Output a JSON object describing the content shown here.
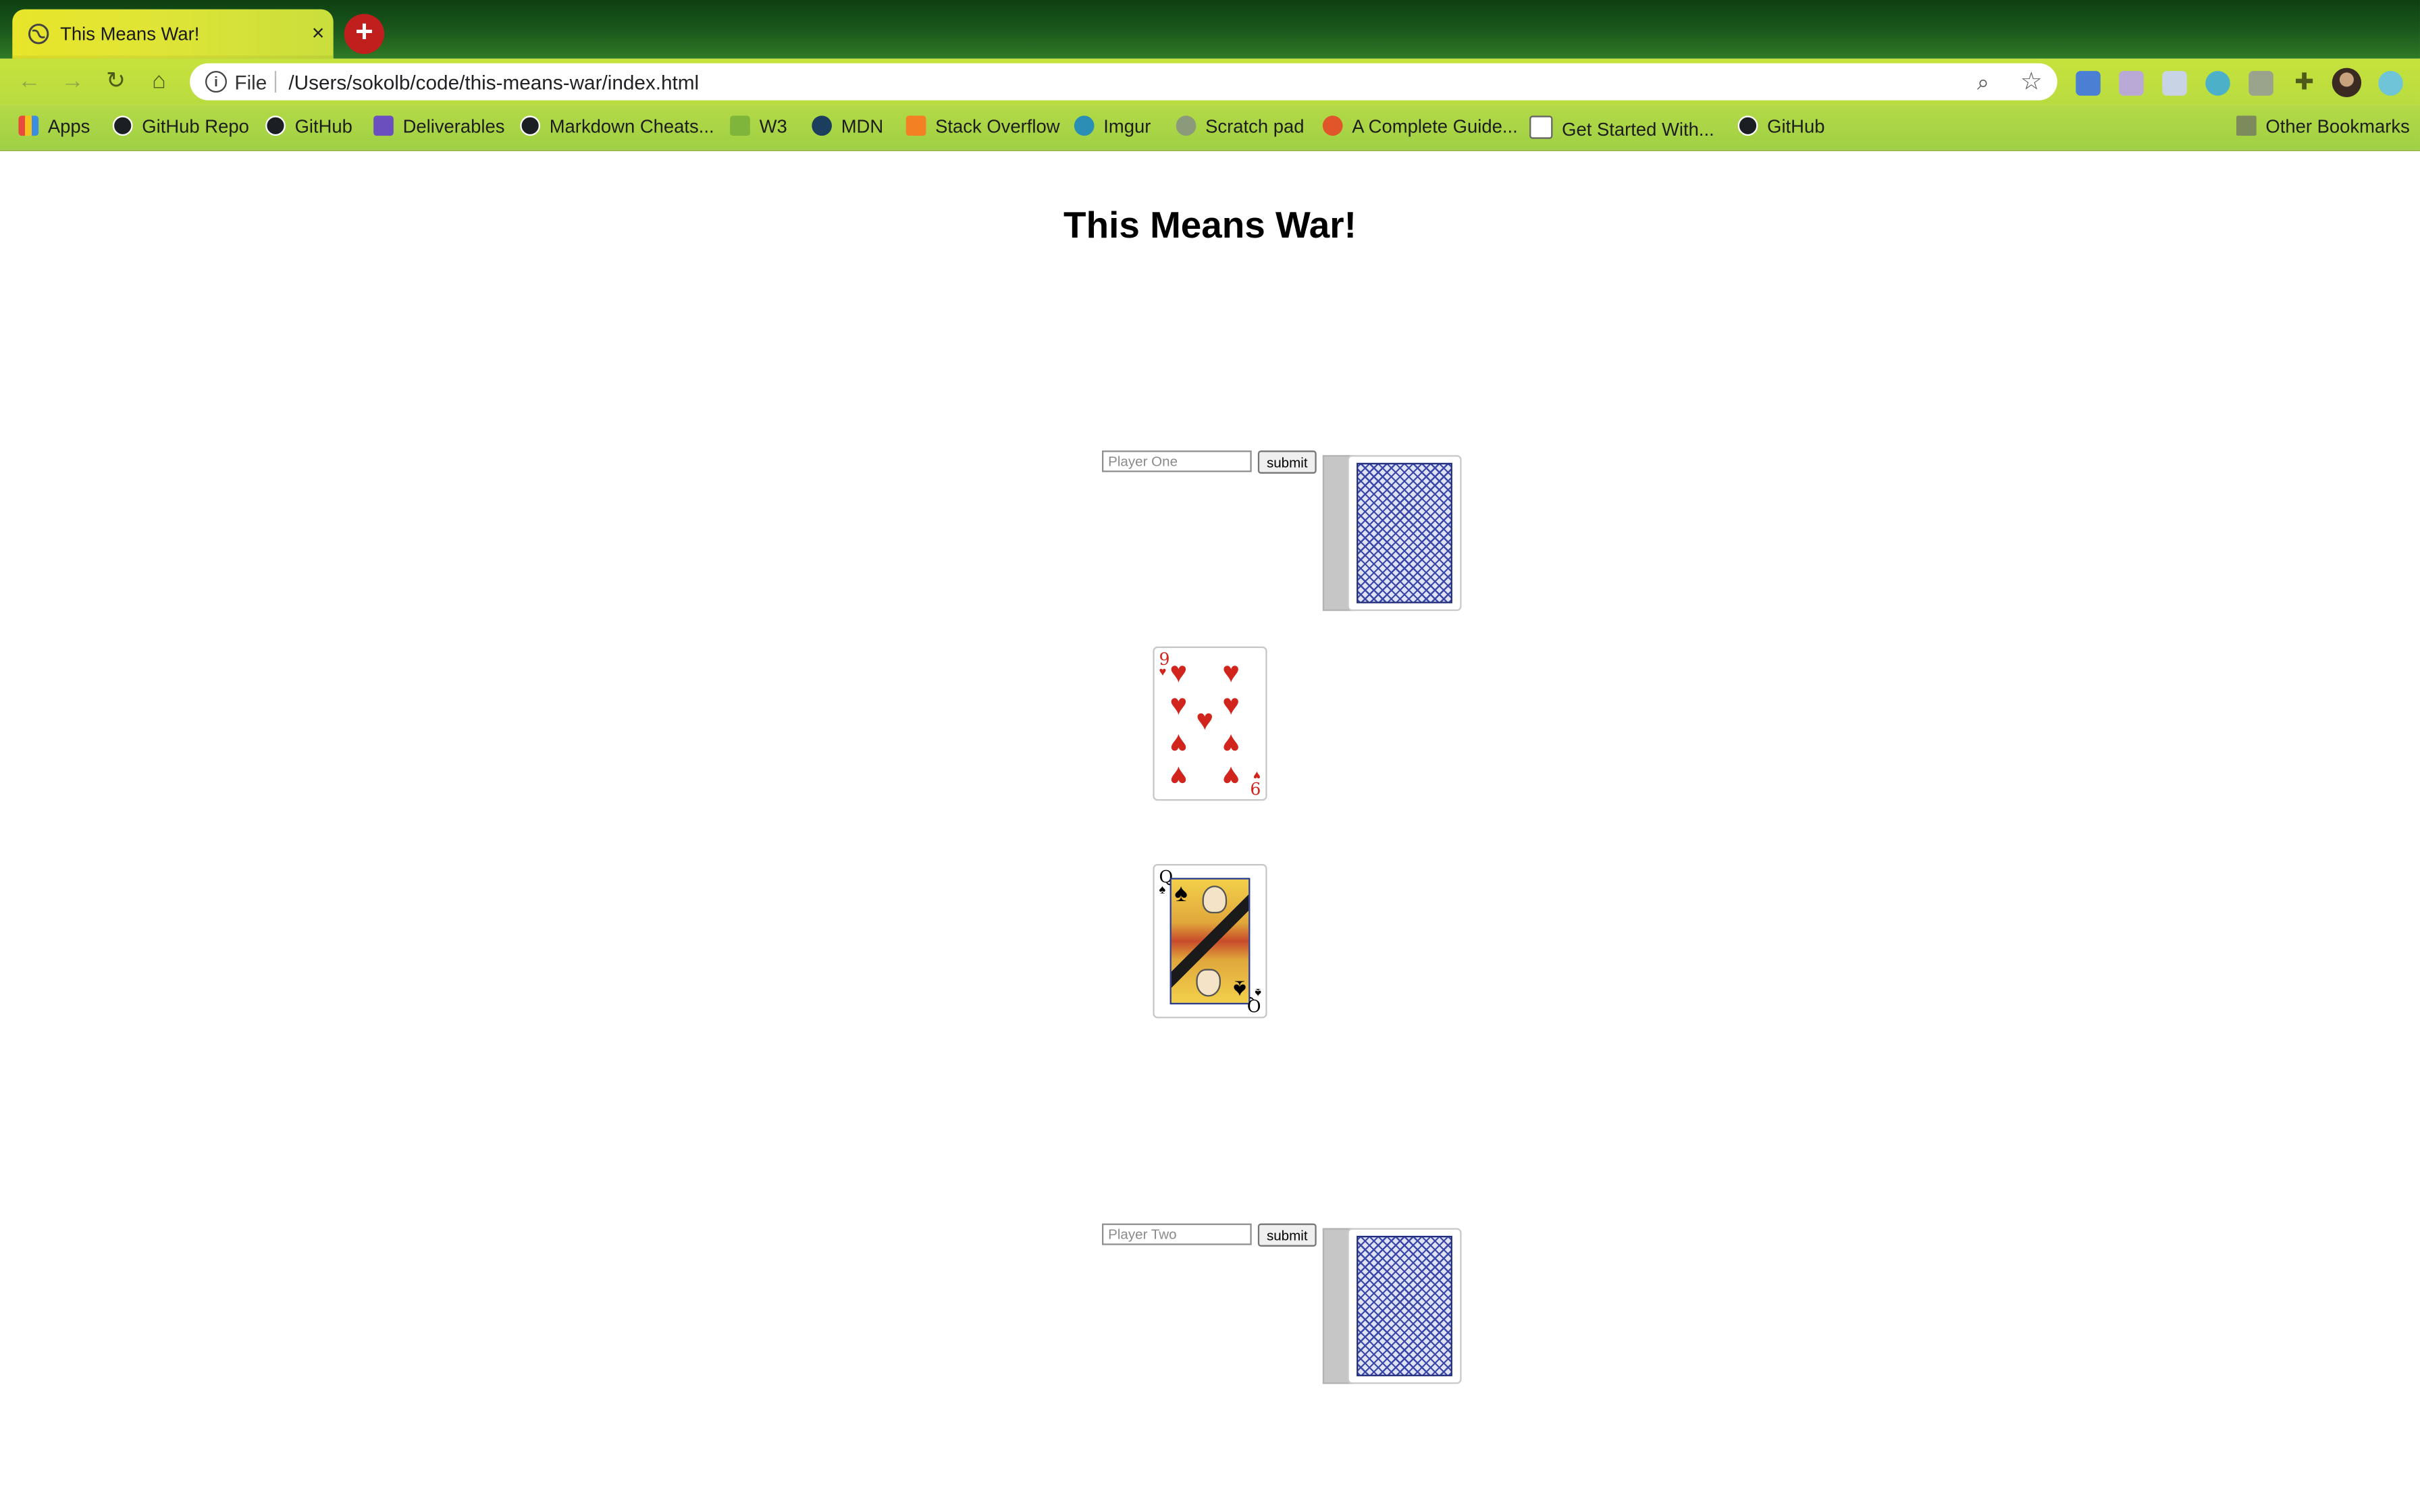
{
  "browser": {
    "tab_title": "This Means War!",
    "tab_close_glyph": "×",
    "new_tab_glyph": "+",
    "scheme_label": "File",
    "url": "/Users/sokolb/code/this-means-war/index.html",
    "bookmarks": [
      {
        "label": "Apps",
        "icon": "apps-grid-icon"
      },
      {
        "label": "GitHub Repo",
        "icon": "github-icon"
      },
      {
        "label": "GitHub",
        "icon": "github-icon"
      },
      {
        "label": "Deliverables",
        "icon": "list-icon"
      },
      {
        "label": "Markdown Cheats...",
        "icon": "github-icon"
      },
      {
        "label": "W3",
        "icon": "w3-icon"
      },
      {
        "label": "MDN",
        "icon": "mdn-icon"
      },
      {
        "label": "Stack Overflow",
        "icon": "stackoverflow-icon"
      },
      {
        "label": "Imgur",
        "icon": "imgur-icon"
      },
      {
        "label": "Scratch pad",
        "icon": "globe-icon"
      },
      {
        "label": "A Complete Guide...",
        "icon": "css-tricks-icon"
      },
      {
        "label": "Get Started With...",
        "icon": "code-icon"
      },
      {
        "label": "GitHub",
        "icon": "github-icon"
      }
    ],
    "other_bookmarks": "Other Bookmarks",
    "colors": {
      "theme_dark_green": "#0d3f12",
      "theme_lime": "#c6e23c",
      "new_tab_red": "#c11e1e"
    }
  },
  "page": {
    "title": "This Means War!",
    "player_one": {
      "placeholder": "Player One",
      "submit_label": "submit"
    },
    "player_two": {
      "placeholder": "Player Two",
      "submit_label": "submit"
    },
    "played_cards": [
      {
        "rank": "9",
        "suit": "♥",
        "suit_name": "hearts",
        "color": "#d0241c"
      },
      {
        "rank": "Q",
        "suit": "♠",
        "suit_name": "spades",
        "color": "#000000"
      }
    ],
    "deck_back_color": "#1f2b7a"
  }
}
